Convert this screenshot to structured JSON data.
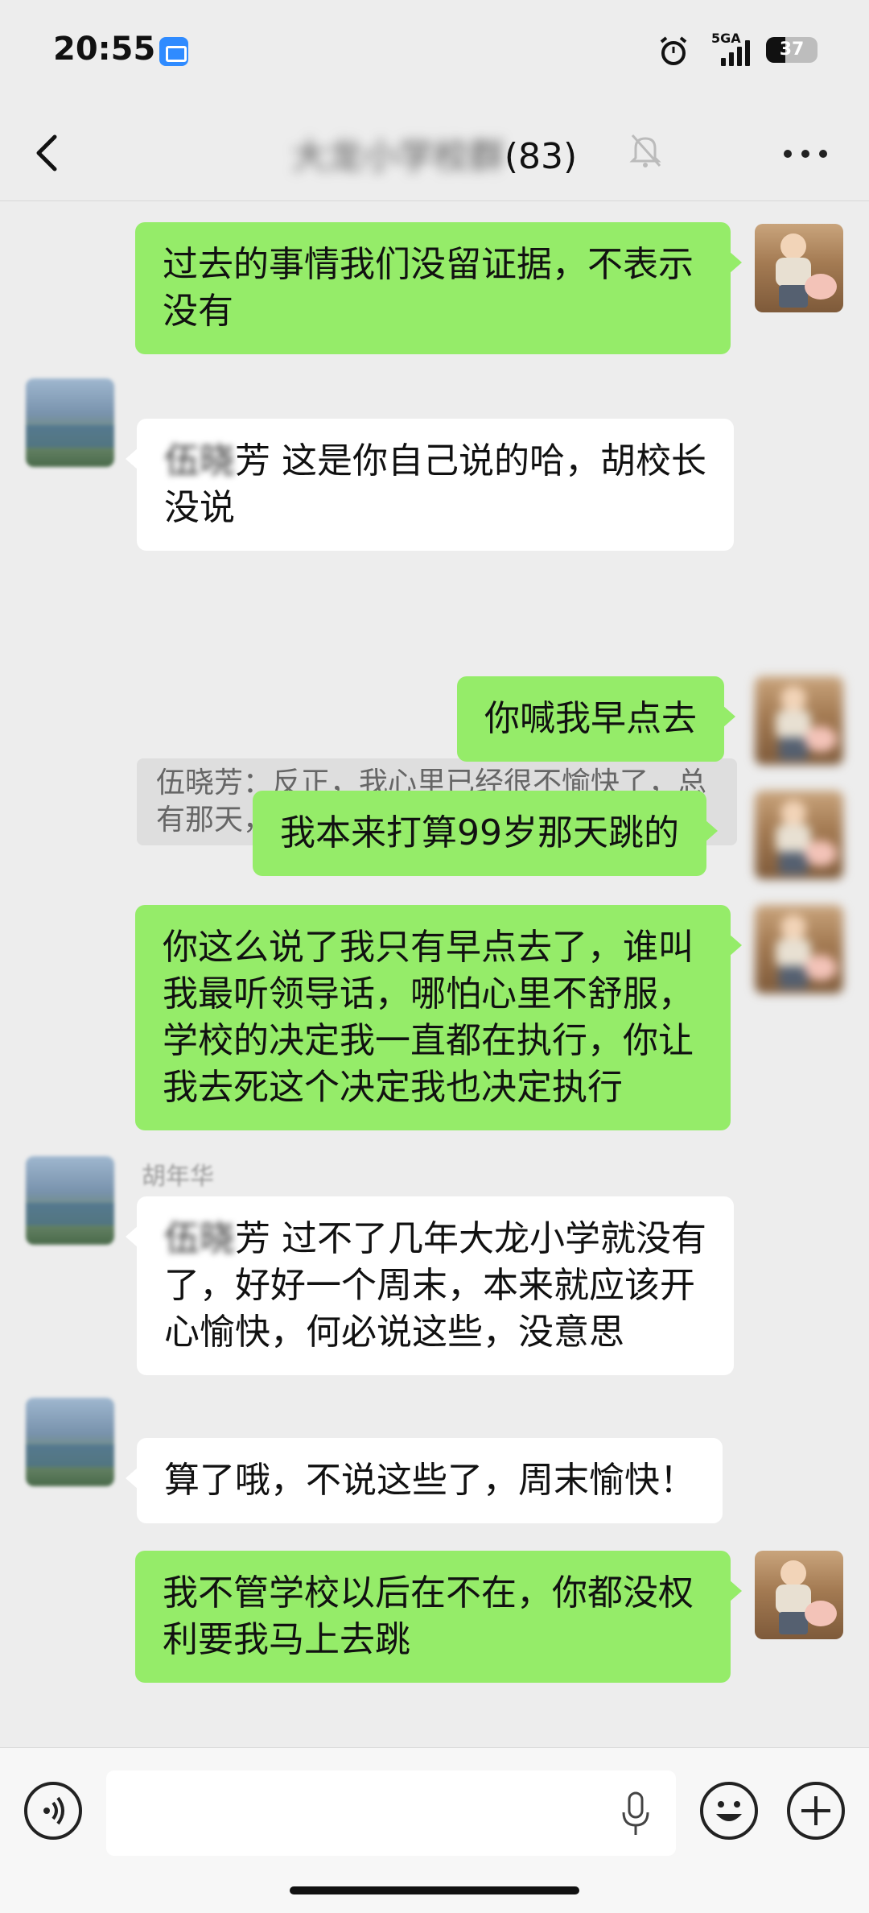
{
  "status_bar": {
    "time": "20:55",
    "network": "5GA",
    "battery": "37",
    "battery_level": 0.37
  },
  "header": {
    "title_hidden": "大龙小学校群",
    "title_visible": "(83)",
    "icons": [
      "back-icon",
      "mute-icon",
      "more-icon"
    ]
  },
  "messages": [
    {
      "side": "me",
      "text": "过去的事情我们没留证据，不表示没有"
    },
    {
      "side": "other",
      "sender": "",
      "mention": "伍晓",
      "text": "芳  这是你自己说的哈，胡校长没说",
      "quote": "伍晓芳：反正，我心里已经很不愉快了，总有那天，我要在大龙小学跳楼"
    },
    {
      "side": "me",
      "text": "你喊我早点去"
    },
    {
      "side": "me",
      "text": "我本来打算99岁那天跳的"
    },
    {
      "side": "me",
      "text": "你这么说了我只有早点去了，谁叫我最听领导话，哪怕心里不舒服，学校的决定我一直都在执行，你让我去死这个决定我也决定执行"
    },
    {
      "side": "other",
      "sender": "胡年华",
      "mention": "伍晓",
      "text": "芳  过不了几年大龙小学就没有了，好好一个周末，本来就应该开心愉快，何必说这些，没意思"
    },
    {
      "side": "other",
      "sender": "",
      "mention": "",
      "text": "算了哦，不说这些了，周末愉快！"
    },
    {
      "side": "me",
      "text": "我不管学校以后在不在，你都没权利要我马上去跳"
    }
  ],
  "input_bar": {
    "placeholder": "",
    "icons": [
      "voice-icon",
      "microphone-icon",
      "emoji-icon",
      "plus-icon"
    ]
  },
  "colors": {
    "chat_background": "#ededed",
    "my_bubble": "#95ec69",
    "other_bubble": "#ffffff",
    "quote_background": "#dedede"
  }
}
